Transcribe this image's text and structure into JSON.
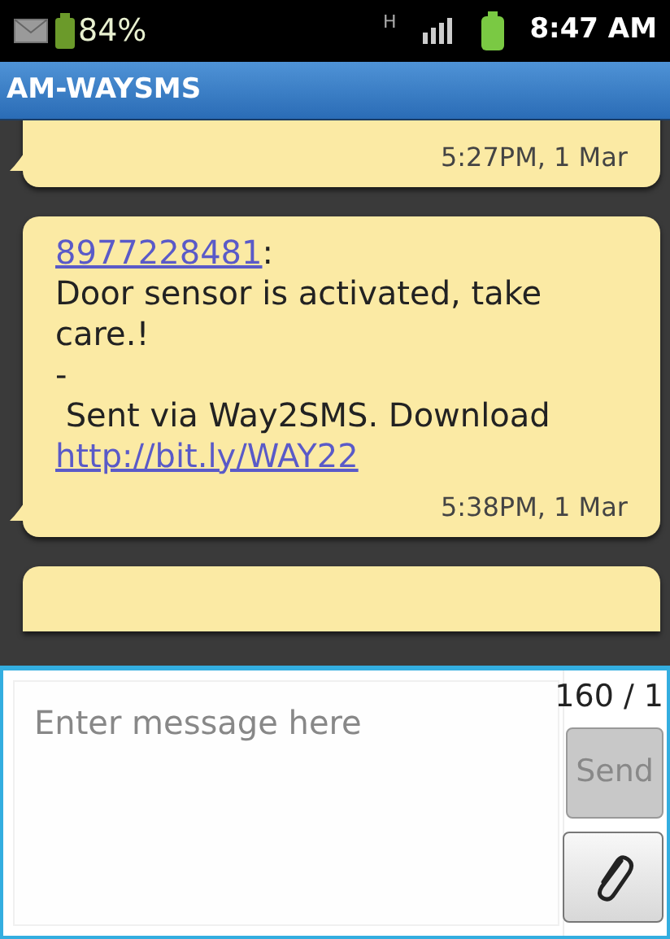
{
  "status_bar": {
    "battery_percent": "84%",
    "time": "8:47 AM",
    "network": "H"
  },
  "title": "AM-WAYSMS",
  "messages": [
    {
      "time": "5:27PM, 1 Mar"
    },
    {
      "sender": "8977228481",
      "sender_separator": ":",
      "body": [
        "Door sensor is activated, take care.!",
        "-",
        " Sent via Way2SMS. Download"
      ],
      "link": "http://bit.ly/WAY22",
      "time": "5:38PM, 1 Mar"
    },
    {
      "kind": "partial"
    }
  ],
  "compose": {
    "placeholder": "Enter message here",
    "counter": "160 / 1",
    "send": {
      "label": "Send",
      "disabled": true
    }
  }
}
